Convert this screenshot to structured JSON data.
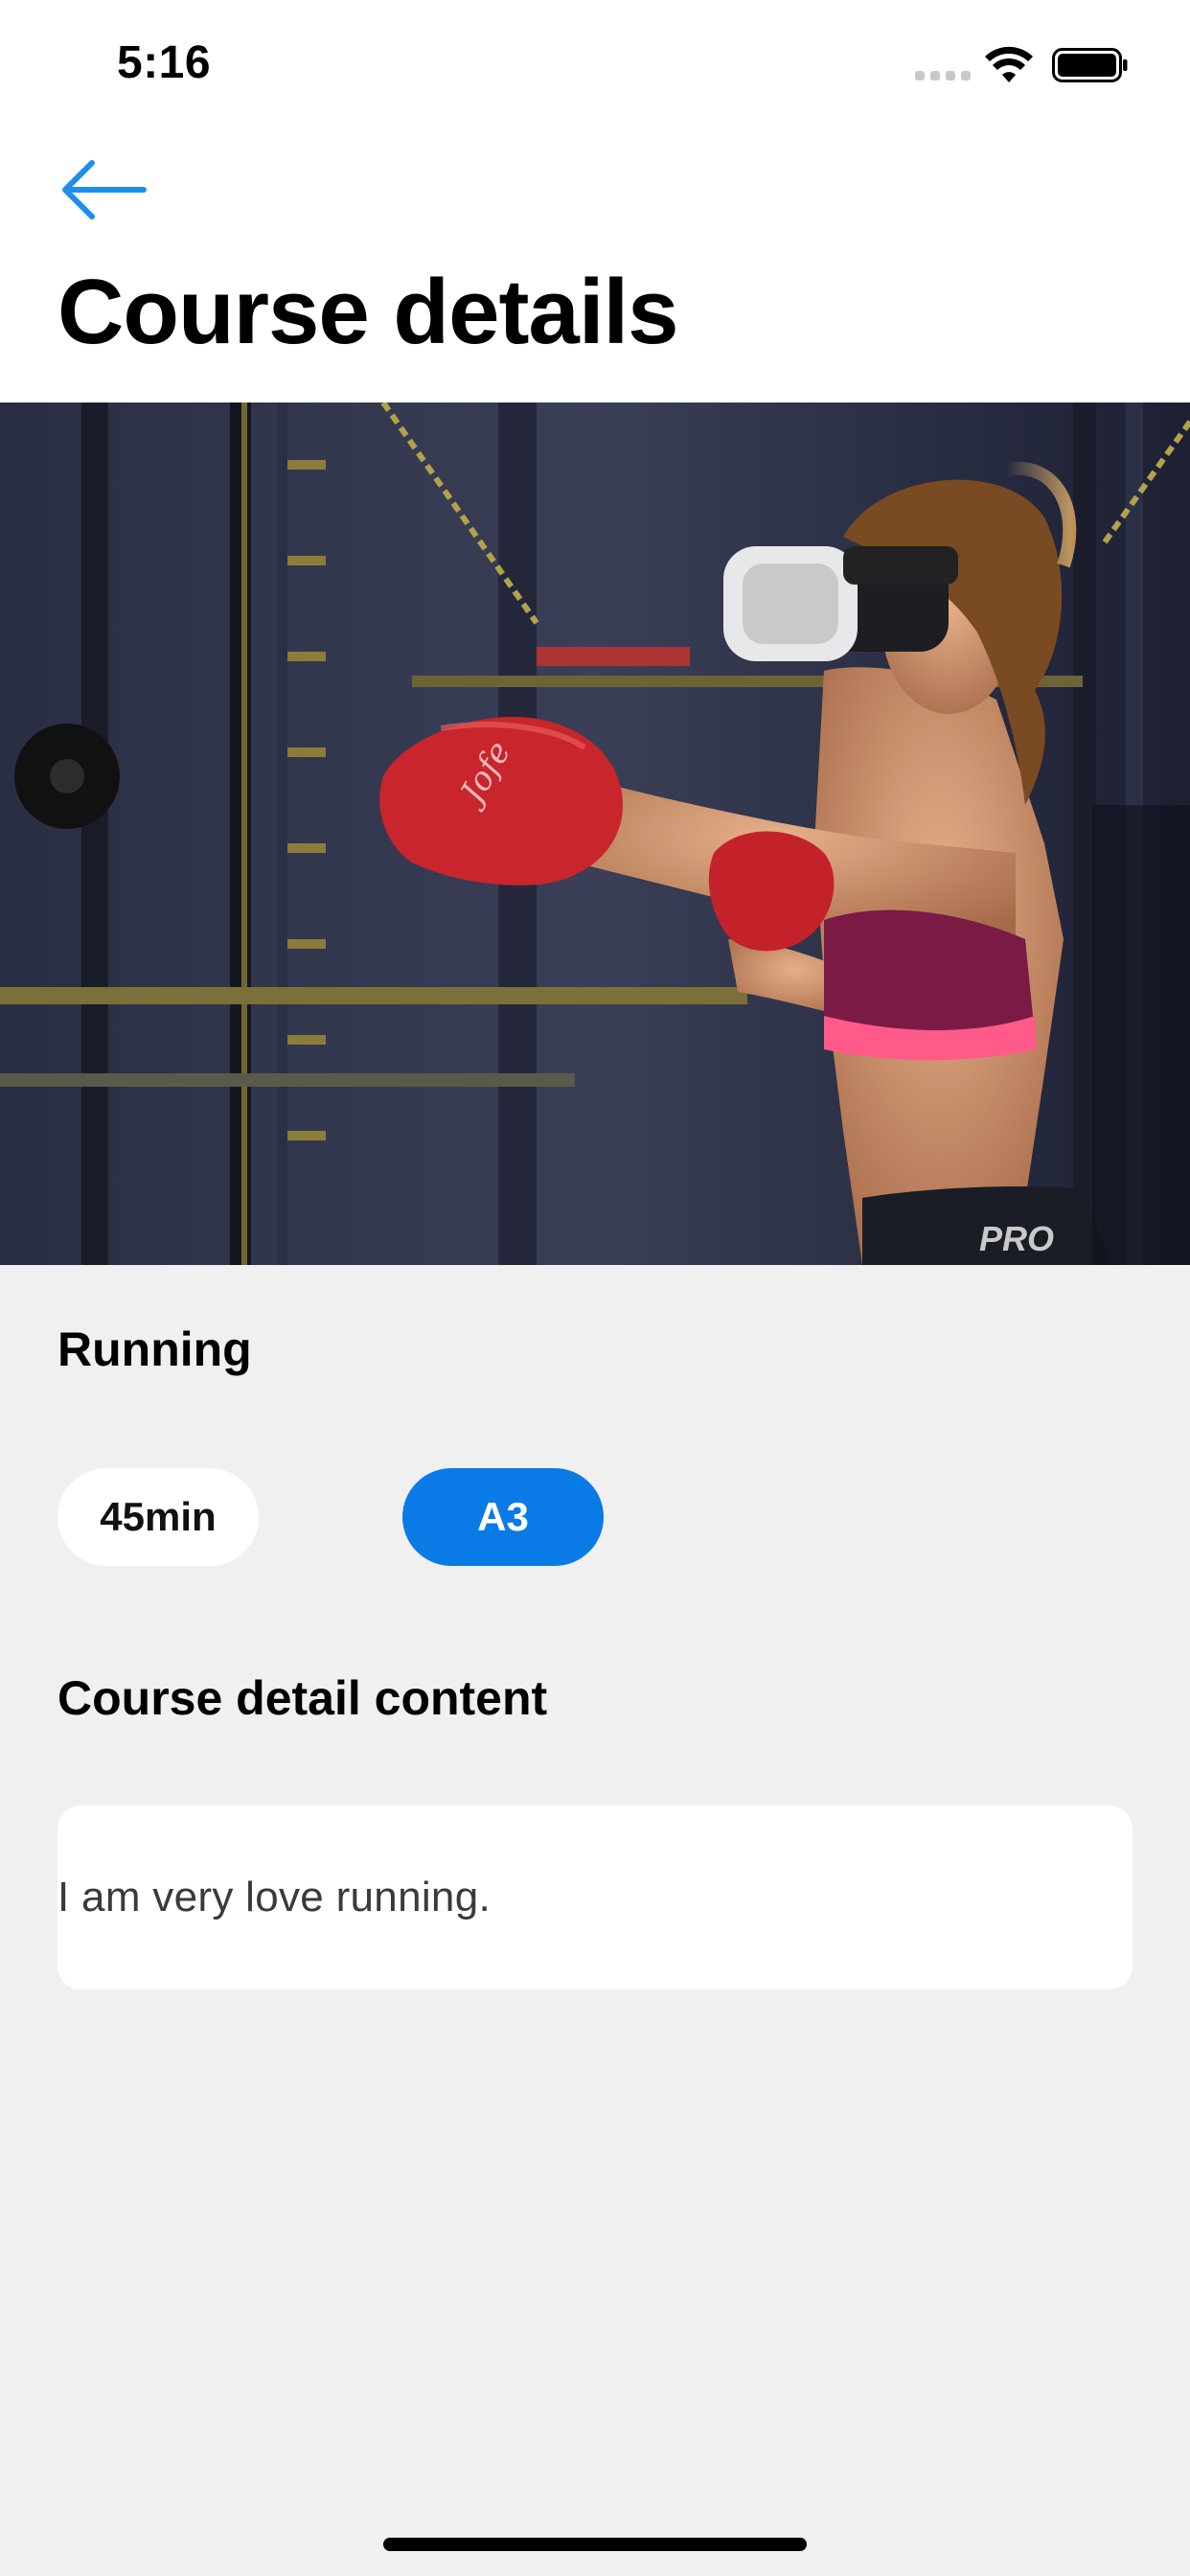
{
  "status_bar": {
    "time": "5:16"
  },
  "header": {
    "back_icon": "arrow-left-icon",
    "title": "Course details"
  },
  "hero_image": {
    "description_icon": "course-cover-photo",
    "gloves_brand": "Jofe",
    "shorts_text": "PRO"
  },
  "course": {
    "name": "Running",
    "duration": "45min",
    "level": "A3"
  },
  "detail": {
    "heading": "Course detail content",
    "text": "I am very love running."
  },
  "colors": {
    "accent": "#0a7ae6",
    "back_arrow": "#1e8fe8",
    "background": "#f0f0f0",
    "card": "#ffffff"
  }
}
